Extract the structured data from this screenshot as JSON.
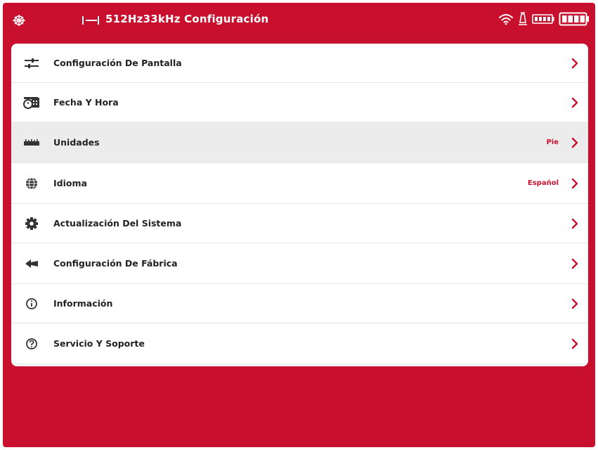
{
  "header": {
    "title": "512Hz33kHz Configuración",
    "accent_color": "#c8102e"
  },
  "status_icons": [
    "wifi-icon",
    "sonde-icon",
    "battery-small-icon",
    "battery-icon"
  ],
  "menu": {
    "items": [
      {
        "label": "Configuración De Pantalla",
        "value": "",
        "icon": "sliders-icon"
      },
      {
        "label": "Fecha Y Hora",
        "value": "",
        "icon": "calendar-clock-icon"
      },
      {
        "label": "Unidades",
        "value": "Pie",
        "icon": "ruler-icon",
        "selected": true
      },
      {
        "label": "Idioma",
        "value": "Español",
        "icon": "globe-icon"
      },
      {
        "label": "Actualización Del Sistema",
        "value": "",
        "icon": "gear-icon"
      },
      {
        "label": "Configuración De Fábrica",
        "value": "",
        "icon": "reset-arrow-icon"
      },
      {
        "label": "Información",
        "value": "",
        "icon": "info-icon"
      },
      {
        "label": "Servicio Y Soporte",
        "value": "",
        "icon": "support-icon"
      }
    ]
  }
}
